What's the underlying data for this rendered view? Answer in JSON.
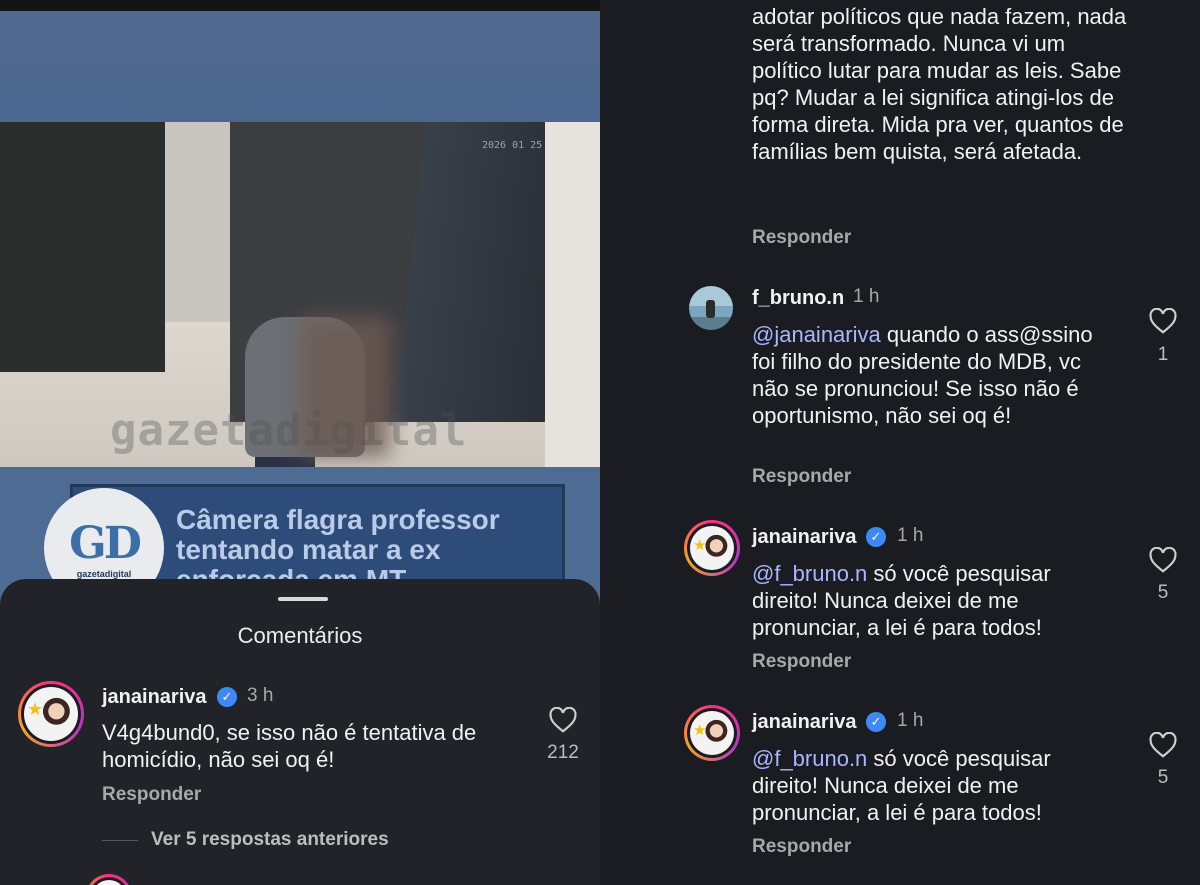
{
  "post": {
    "watermark": "gazetadigital",
    "headline": "Câmera flagra professor tentando matar a ex enforcada em MT",
    "logo_letters": "GD",
    "logo_tag": "gazetadigital"
  },
  "sheet": {
    "title": "Comentários"
  },
  "left_comments": [
    {
      "user": "janainariva",
      "verified": true,
      "time": "3 h",
      "text": "V4g4bund0, se isso não é tentativa de homicídio, não sei oq é!",
      "reply_label": "Responder",
      "likes": "212"
    }
  ],
  "view_replies": "Ver 5 respostas anteriores",
  "right": {
    "tail_text": "adotar políticos que nada fazem, nada será transformado. Nunca vi um político lutar para mudar as leis. Sabe pq? Mudar a lei significa atingi-los de forma direta. Mida pra ver, quantos de famílias bem quista, será afetada.",
    "tail_reply": "Responder",
    "comments": [
      {
        "user": "f_bruno.n",
        "time": "1 h",
        "mention": "@janainariva",
        "text": " quando o ass@ssino foi filho do presidente do MDB, vc não se pronunciou! Se isso não é oportunismo, não sei oq é!",
        "reply_label": "Responder",
        "likes": "1"
      },
      {
        "user": "janainariva",
        "time": "1 h",
        "mention": "@f_bruno.n",
        "text": " só você pesquisar direito! Nunca deixei de me pronunciar, a lei é para todos!",
        "reply_label": "Responder",
        "likes": "5"
      },
      {
        "user": "janainariva",
        "time": "1 h",
        "mention": "@f_bruno.n",
        "text": " só você pesquisar direito! Nunca deixei de me pronunciar, a lei é para todos!",
        "reply_label": "Responder",
        "likes": "5"
      }
    ]
  }
}
